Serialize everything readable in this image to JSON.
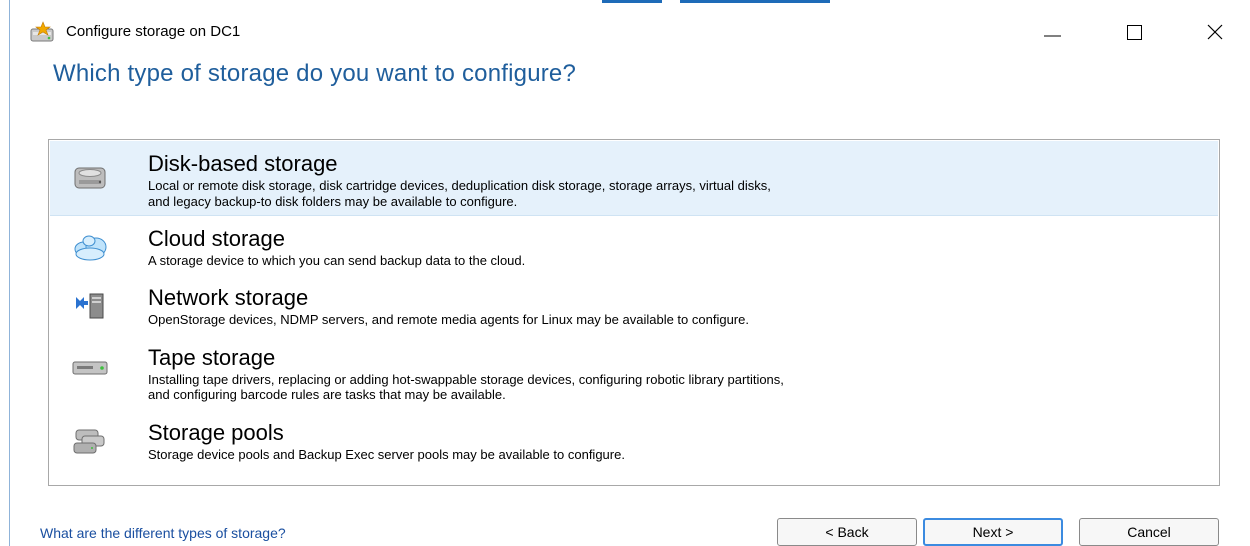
{
  "window": {
    "title": "Configure storage on DC1",
    "icon": "storage-wizard-icon",
    "controls": [
      "minimize-icon",
      "maximize-icon",
      "close-icon"
    ]
  },
  "heading": "Which type of storage do you want to configure?",
  "options": [
    {
      "title": "Disk-based storage",
      "desc_line1": "Local or remote disk storage, disk cartridge devices, deduplication disk storage, storage arrays, virtual disks,",
      "desc_line2": "and legacy backup-to disk folders may be available to configure.",
      "icon": "hard-disk-icon",
      "selected": true
    },
    {
      "title": "Cloud storage",
      "desc_line1": "A storage device to which you can send backup data to the cloud.",
      "icon": "cloud-icon",
      "selected": false
    },
    {
      "title": "Network storage",
      "desc_line1": "OpenStorage devices, NDMP servers, and remote media agents for Linux may be available to configure.",
      "icon": "network-server-icon",
      "selected": false
    },
    {
      "title": "Tape storage",
      "desc_line1": "Installing tape drivers, replacing or adding hot-swappable storage devices, configuring robotic library partitions,",
      "desc_line2": "and configuring barcode rules are tasks that may be available.",
      "icon": "tape-drive-icon",
      "selected": false
    },
    {
      "title": "Storage pools",
      "desc_line1": "Storage device pools and Backup Exec server pools may be available to configure.",
      "icon": "storage-pool-icon",
      "selected": false
    }
  ],
  "footer": {
    "help_link": "What are the different types of storage?",
    "back_label": "< Back",
    "next_label": "Next >",
    "cancel_label": "Cancel"
  },
  "colors": {
    "heading": "#1f5e9c",
    "selected_row": "#e5f1fb",
    "link": "#1a4fa0",
    "default_button_border": "#3c8be0"
  }
}
